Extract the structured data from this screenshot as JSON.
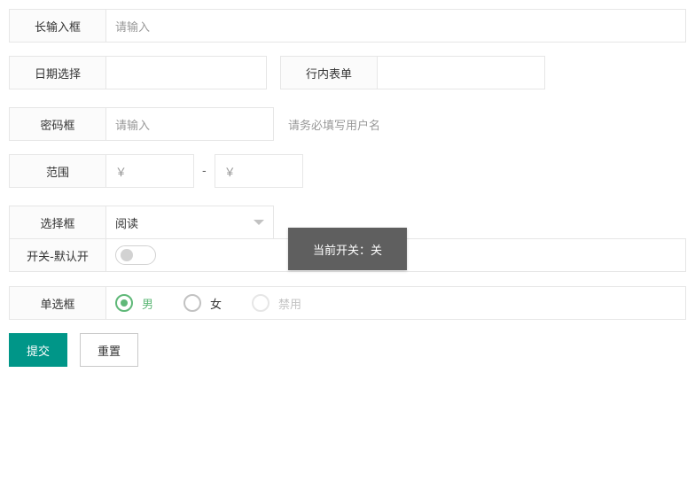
{
  "form": {
    "long_input": {
      "label": "长输入框",
      "placeholder": "请输入"
    },
    "date": {
      "label": "日期选择",
      "value": ""
    },
    "inline": {
      "label": "行内表单",
      "value": ""
    },
    "password": {
      "label": "密码框",
      "placeholder": "请输入",
      "aux": "请务必填写用户名"
    },
    "range": {
      "label": "范围",
      "min_placeholder": "￥",
      "sep": "-",
      "max_placeholder": "￥"
    },
    "select": {
      "label": "选择框",
      "value": "阅读"
    },
    "switch": {
      "label": "开关-默认开",
      "state": "off"
    },
    "radio": {
      "label": "单选框",
      "options": [
        {
          "label": "男",
          "checked": true,
          "disabled": false
        },
        {
          "label": "女",
          "checked": false,
          "disabled": false
        },
        {
          "label": "禁用",
          "checked": false,
          "disabled": true
        }
      ]
    },
    "buttons": {
      "submit": "提交",
      "reset": "重置"
    }
  },
  "toast": {
    "text": "当前开关：关"
  },
  "colors": {
    "primary": "#009688",
    "radio_checked": "#5fb878",
    "border": "#e6e6e6",
    "label_bg": "#fbfbfb"
  }
}
